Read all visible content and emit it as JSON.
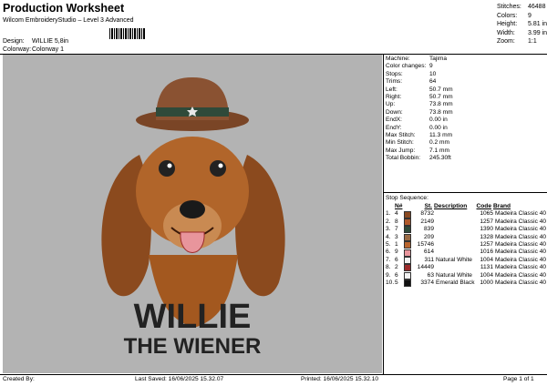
{
  "header": {
    "title": "Production Worksheet",
    "subtitle": "Wilcom EmbroideryStudio – Level 3 Advanced",
    "design_label": "Design:",
    "design_value": "WILLIE 5,8in",
    "colorway_label": "Colorway:",
    "colorway_value": "Colorway 1"
  },
  "stats": [
    {
      "k": "Stitches:",
      "v": "46488"
    },
    {
      "k": "Colors:",
      "v": "9"
    },
    {
      "k": "Height:",
      "v": "5.81 in"
    },
    {
      "k": "Width:",
      "v": "3.99 in"
    },
    {
      "k": "Zoom:",
      "v": "1:1"
    }
  ],
  "info": [
    {
      "k": "Machine:",
      "v": "Tajima"
    },
    {
      "k": "Color changes:",
      "v": "9"
    },
    {
      "k": "Stops:",
      "v": "10"
    },
    {
      "k": "Trims:",
      "v": "64"
    },
    {
      "k": "Left:",
      "v": "50.7 mm"
    },
    {
      "k": "Right:",
      "v": "50.7 mm"
    },
    {
      "k": "Up:",
      "v": "73.8 mm"
    },
    {
      "k": "Down:",
      "v": "73.8 mm"
    },
    {
      "k": "EndX:",
      "v": "0.00 in"
    },
    {
      "k": "EndY:",
      "v": "0.00 in"
    },
    {
      "k": "Max Stitch:",
      "v": "11.3 mm"
    },
    {
      "k": "Min Stitch:",
      "v": "0.2 mm"
    },
    {
      "k": "Max Jump:",
      "v": "7.1 mm"
    },
    {
      "k": "Total Bobbin:",
      "v": "245.30ft"
    }
  ],
  "sequence": {
    "title": "Stop Sequence:",
    "headers": {
      "n": "N#",
      "st": "St.",
      "desc": "Description",
      "code": "Code",
      "brand": "Brand"
    },
    "rows": [
      {
        "i": "1.",
        "n": "4",
        "color": "#8a4a22",
        "st": "8732",
        "desc": "",
        "code": "1065",
        "brand": "Madeira Classic 40"
      },
      {
        "i": "2.",
        "n": "8",
        "color": "#b05a2c",
        "st": "2149",
        "desc": "",
        "code": "1257",
        "brand": "Madeira Classic 40"
      },
      {
        "i": "3.",
        "n": "7",
        "color": "#2f4a3a",
        "st": "839",
        "desc": "",
        "code": "1390",
        "brand": "Madeira Classic 40"
      },
      {
        "i": "4.",
        "n": "3",
        "color": "#9a6a44",
        "st": "209",
        "desc": "",
        "code": "1328",
        "brand": "Madeira Classic 40"
      },
      {
        "i": "5.",
        "n": "1",
        "color": "#b9652e",
        "st": "15746",
        "desc": "",
        "code": "1257",
        "brand": "Madeira Classic 40"
      },
      {
        "i": "6.",
        "n": "9",
        "color": "#e8959c",
        "st": "614",
        "desc": "",
        "code": "1016",
        "brand": "Madeira Classic 40"
      },
      {
        "i": "7.",
        "n": "6",
        "color": "#f2f2f2",
        "st": "311",
        "desc": "Natural White",
        "code": "1004",
        "brand": "Madeira Classic 40"
      },
      {
        "i": "8.",
        "n": "2",
        "color": "#9c2a2a",
        "st": "14449",
        "desc": "",
        "code": "1131",
        "brand": "Madeira Classic 40"
      },
      {
        "i": "9.",
        "n": "6",
        "color": "#f2f2f2",
        "st": "63",
        "desc": "Natural White",
        "code": "1004",
        "brand": "Madeira Classic 40"
      },
      {
        "i": "10.",
        "n": "5",
        "color": "#111111",
        "st": "3374",
        "desc": "Emerald Black",
        "code": "1000",
        "brand": "Madeira Classic 40"
      }
    ]
  },
  "canvas": {
    "line1": "WILLIE",
    "line2": "THE WIENER"
  },
  "footer": {
    "created": "Created By:",
    "saved": "Last Saved: 16/06/2025 15.32.07",
    "printed": "Printed: 16/06/2025 15.32.10",
    "page": "Page 1 of 1"
  }
}
